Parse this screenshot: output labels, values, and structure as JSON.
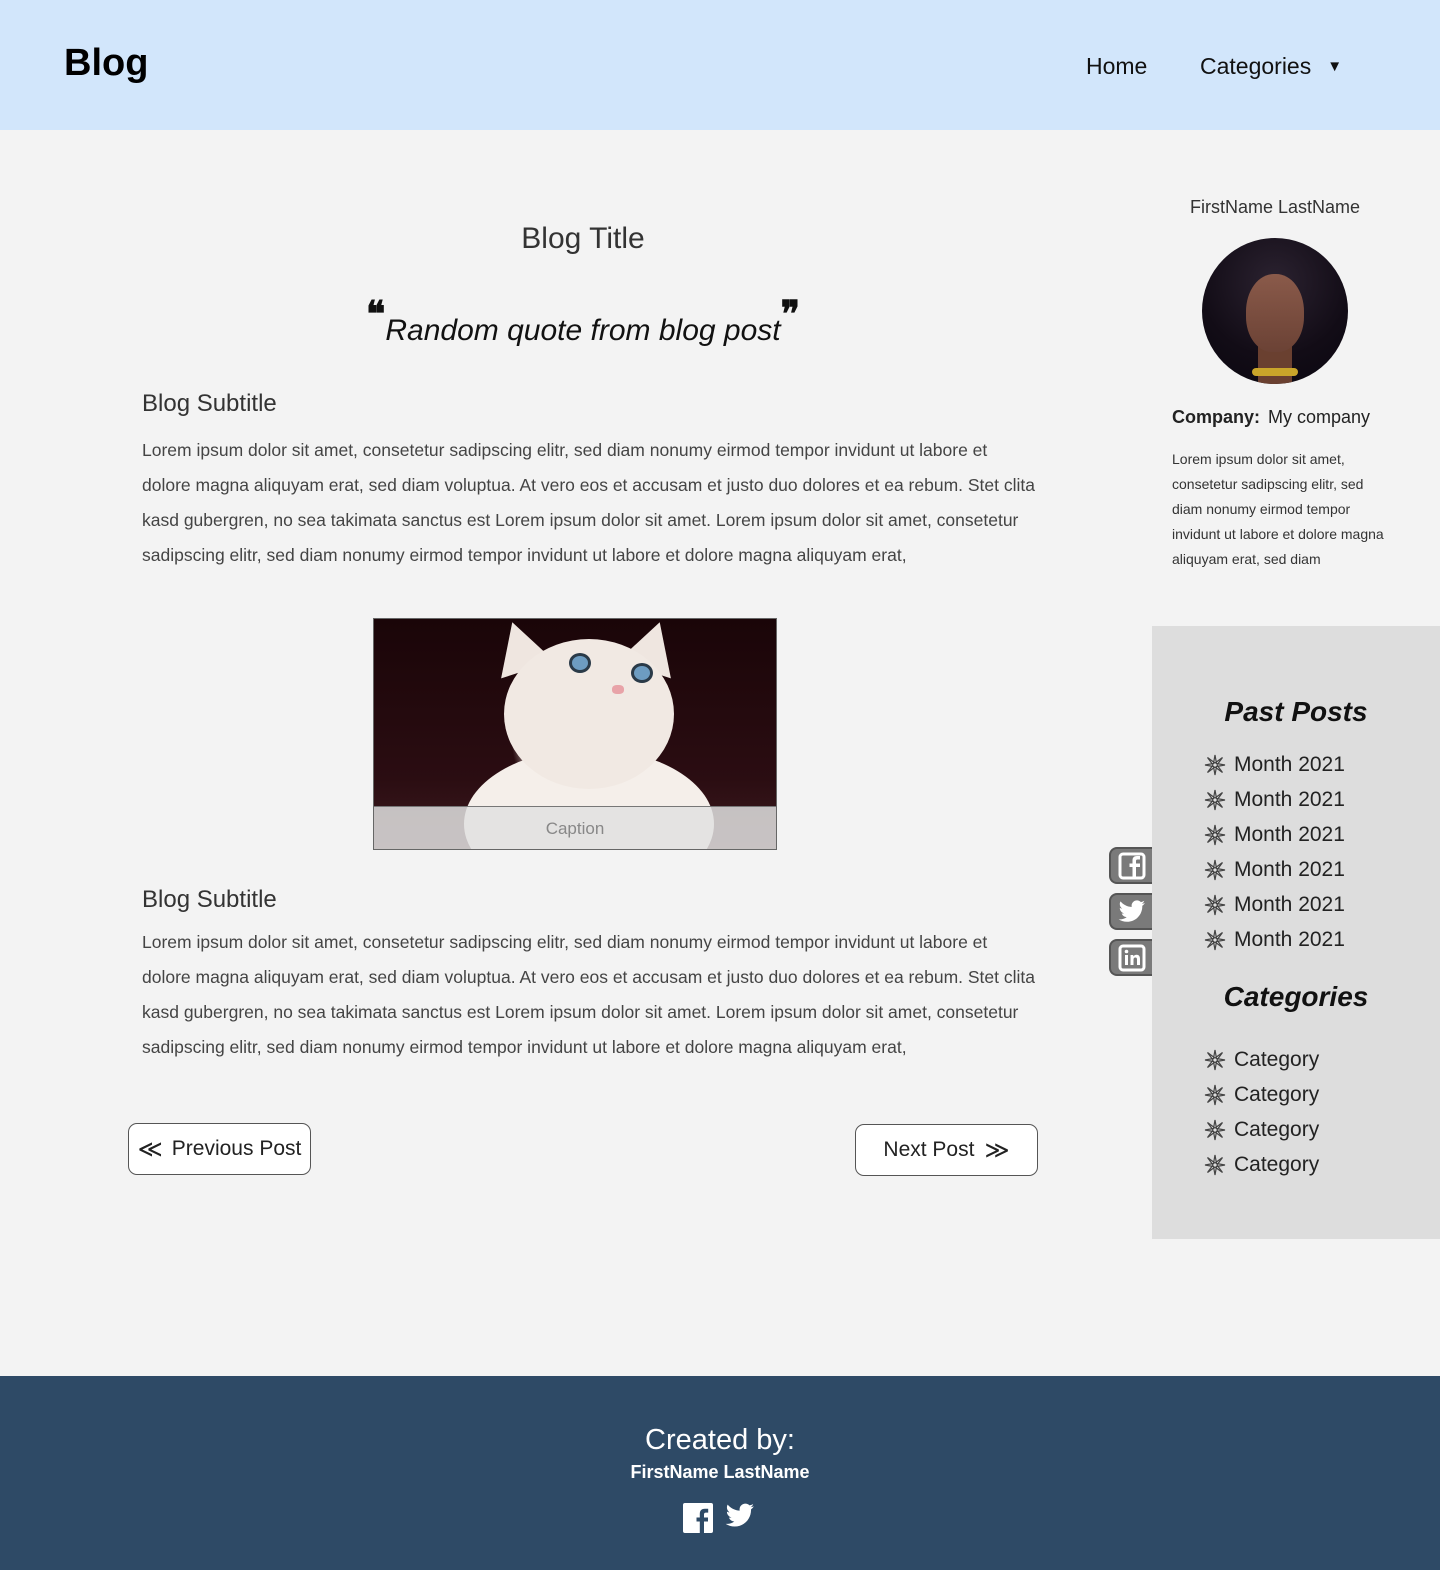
{
  "header": {
    "brand": "Blog",
    "nav": {
      "home": "Home",
      "categories": "Categories"
    }
  },
  "article": {
    "title": "Blog Title",
    "quote": "Random quote from blog post",
    "sections": [
      {
        "subtitle": "Blog Subtitle",
        "body": "Lorem ipsum dolor sit amet, consetetur sadipscing elitr, sed diam nonumy eirmod tempor invidunt ut labore et dolore magna aliquyam erat, sed diam voluptua. At vero eos et accusam et justo duo dolores et ea rebum. Stet clita kasd gubergren, no sea takimata sanctus est Lorem ipsum dolor sit amet. Lorem ipsum dolor sit amet, consetetur sadipscing elitr, sed diam nonumy eirmod tempor invidunt ut labore et dolore magna aliquyam erat,"
      },
      {
        "subtitle": "Blog Subtitle",
        "body": "Lorem ipsum dolor sit amet, consetetur sadipscing elitr, sed diam nonumy eirmod tempor invidunt ut labore et dolore magna aliquyam erat, sed diam voluptua. At vero eos et accusam et justo duo dolores et ea rebum. Stet clita kasd gubergren, no sea takimata sanctus est Lorem ipsum dolor sit amet. Lorem ipsum dolor sit amet, consetetur sadipscing elitr, sed diam nonumy eirmod tempor invidunt ut labore et dolore magna aliquyam erat,"
      }
    ],
    "figure": {
      "caption": "Caption"
    },
    "pager": {
      "previous": "Previous Post",
      "next": "Next Post"
    }
  },
  "author": {
    "name": "FirstName LastName",
    "company_label": "Company:",
    "company": "My company",
    "bio": "Lorem ipsum dolor sit amet, consetetur sadipscing elitr, sed diam nonumy eirmod tempor invidunt ut labore et dolore magna aliquyam erat, sed diam"
  },
  "social": [
    "facebook-icon",
    "twitter-icon",
    "linkedin-icon"
  ],
  "archive": {
    "past_posts_heading": "Past Posts",
    "past_posts": [
      "Month 2021",
      "Month 2021",
      "Month 2021",
      "Month 2021",
      "Month 2021",
      "Month 2021"
    ],
    "categories_heading": "Categories",
    "categories": [
      "Category",
      "Category",
      "Category",
      "Category"
    ]
  },
  "footer": {
    "created_by": "Created by:",
    "name": "FirstName LastName"
  },
  "colors": {
    "header_bg": "#d2e6fb",
    "page_bg": "#f3f3f3",
    "panel_bg": "#dddddd",
    "footer_bg": "#2e4a66"
  }
}
